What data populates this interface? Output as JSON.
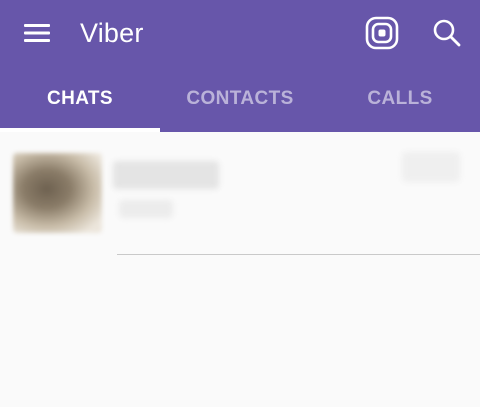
{
  "toolbar": {
    "title": "Viber",
    "background": "#6756aa",
    "menu_icon": "hamburger-menu-icon",
    "actions": [
      {
        "name": "public-accounts-icon"
      },
      {
        "name": "search-icon"
      }
    ]
  },
  "tabs": [
    {
      "label": "CHATS",
      "active": true
    },
    {
      "label": "CONTACTS",
      "active": false
    },
    {
      "label": "CALLS",
      "active": false
    }
  ],
  "chats": [
    {
      "name": "",
      "last_message": "",
      "time": "",
      "avatar_icon": "contact-avatar"
    }
  ]
}
